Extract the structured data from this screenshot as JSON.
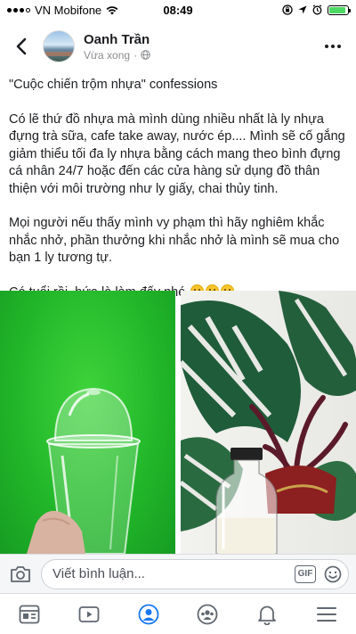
{
  "status_bar": {
    "carrier": "VN Mobifone",
    "time": "08:49",
    "battery_level": 0.9
  },
  "post": {
    "author": "Oanh Trần",
    "time": "Vừa xong",
    "privacy_icon": "globe-icon",
    "paragraphs": [
      "\"Cuộc chiến trộm nhựa\" confessions",
      "Có lẽ thứ đồ nhựa mà mình dùng nhiều nhất là ly nhựa đựng trà sữa, cafe take away, nước ép.... Mình sẽ cố gắng giảm thiểu tối đa ly nhựa bằng cách mang theo bình đựng cá nhân 24/7 hoặc đến các cửa hàng sử dụng đồ thân thiện với môi trường như ly giấy, chai thủy tinh.",
      "Mọi người nếu thấy mình vy phạm thì hãy nghiêm khắc nhắc nhở, phần thưởng khi nhắc nhở là mình sẽ mua cho bạn 1 ly tương tự."
    ],
    "closing": "Có tuổi rồi, hứa là làm đấy nhé"
  },
  "comment_bar": {
    "placeholder": "Viết bình luận...",
    "gif_label": "GIF"
  },
  "tab_bar": {
    "tabs": [
      "news-feed-icon",
      "watch-icon",
      "profile-icon",
      "groups-icon",
      "notifications-icon",
      "menu-icon"
    ],
    "active_color": "#1877f2"
  },
  "colors": {
    "accent": "#1877f2",
    "green_screen": "#22b82a"
  }
}
